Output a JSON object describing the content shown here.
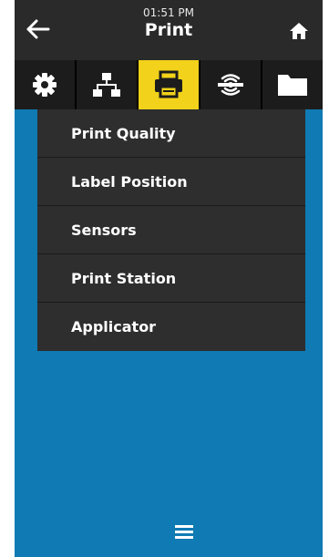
{
  "header": {
    "time": "01:51 PM",
    "title": "Print",
    "back_icon": "arrow-left-icon",
    "home_icon": "home-icon"
  },
  "tabs": [
    {
      "icon": "gear-icon",
      "active": false
    },
    {
      "icon": "network-icon",
      "active": false
    },
    {
      "icon": "printer-icon",
      "active": true
    },
    {
      "icon": "rfid-icon",
      "active": false
    },
    {
      "icon": "folder-icon",
      "active": false
    }
  ],
  "menu": {
    "items": [
      {
        "label": "Print Quality"
      },
      {
        "label": "Label Position"
      },
      {
        "label": "Sensors"
      },
      {
        "label": "Print Station"
      },
      {
        "label": "Applicator"
      }
    ]
  },
  "footer": {
    "menu_icon": "hamburger-menu-icon"
  },
  "colors": {
    "background": "#0f7ab3",
    "header": "#2a2a2a",
    "active_tab": "#f2d21a",
    "menu": "#2e2e2e"
  }
}
